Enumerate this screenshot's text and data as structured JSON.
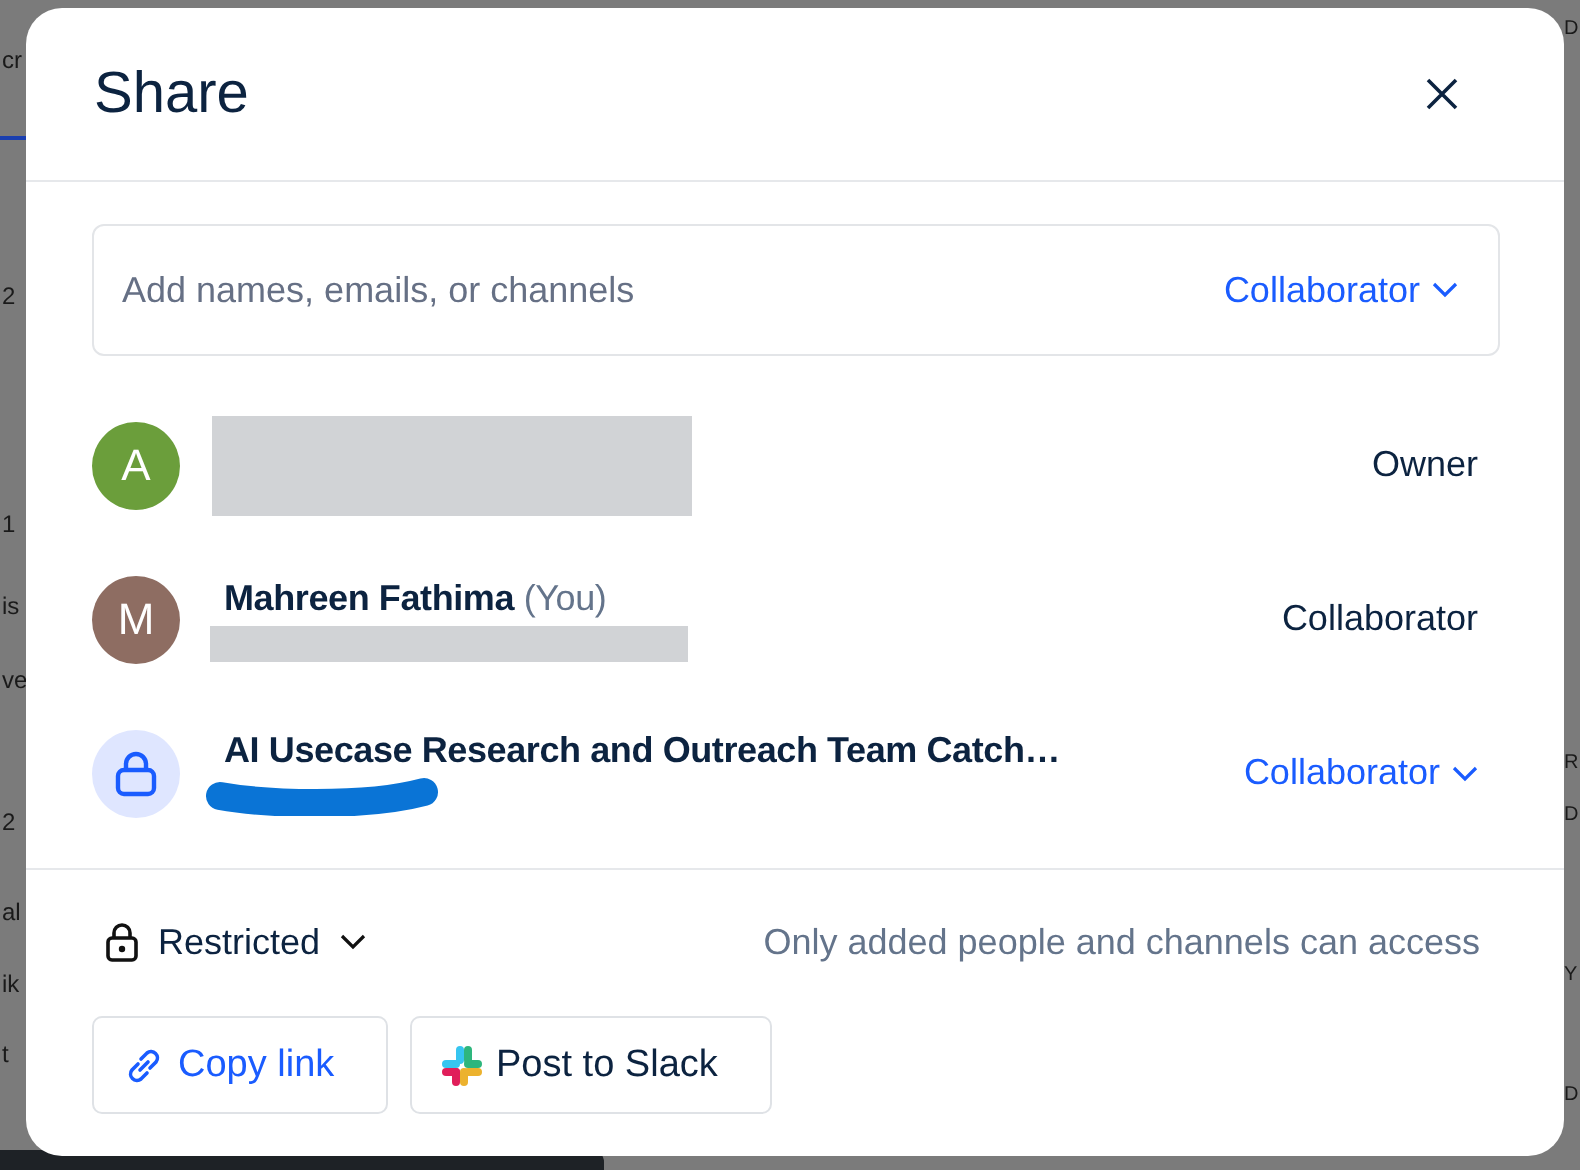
{
  "background": {
    "left_fragments": [
      "cr",
      "2",
      "1",
      "is",
      "ve",
      "2",
      "al",
      "ik",
      "t"
    ],
    "right_fragments": [
      "D",
      "R",
      "D",
      "Y",
      "D"
    ]
  },
  "dialog": {
    "title": "Share",
    "invite": {
      "placeholder": "Add names, emails, or channels",
      "role": "Collaborator"
    },
    "members": [
      {
        "kind": "user",
        "initial": "A",
        "color": "#6b9e3b",
        "redacted": true,
        "role": "Owner",
        "role_menu": false
      },
      {
        "kind": "user",
        "initial": "M",
        "color": "#8e6d62",
        "name": "Mahreen Fathima",
        "you_tag": "(You)",
        "redacted": true,
        "role": "Collaborator",
        "role_menu": false
      },
      {
        "kind": "channel",
        "name": "AI Usecase Research and Outreach Team Catch…",
        "redacted": true,
        "role": "Collaborator",
        "role_menu": true
      }
    ],
    "access": {
      "label": "Restricted",
      "description": "Only added people and channels can access"
    },
    "actions": [
      {
        "kind": "link",
        "label": "Copy link"
      },
      {
        "kind": "slack",
        "label": "Post to Slack"
      }
    ]
  }
}
